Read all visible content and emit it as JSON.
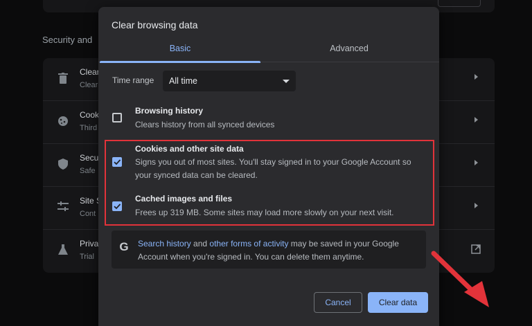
{
  "background": {
    "section_title": "Security and",
    "rows": [
      {
        "t1": "Clear",
        "t2": "Clear",
        "icon": "trash-icon"
      },
      {
        "t1": "Cook",
        "t2": "Third",
        "icon": "cookie-icon"
      },
      {
        "t1": "Secu",
        "t2": "Safe",
        "icon": "shield-icon"
      },
      {
        "t1": "Site S",
        "t2": "Cont",
        "icon": "sliders-icon"
      },
      {
        "t1": "Priva",
        "t2": "Trial",
        "icon": "flask-icon"
      }
    ]
  },
  "dialog": {
    "title": "Clear browsing data",
    "tabs": [
      {
        "label": "Basic",
        "active": true
      },
      {
        "label": "Advanced",
        "active": false
      }
    ],
    "time_range": {
      "label": "Time range",
      "value": "All time"
    },
    "options": [
      {
        "title": "Browsing history",
        "desc": "Clears history from all synced devices",
        "checked": false
      },
      {
        "title": "Cookies and other site data",
        "desc": "Signs you out of most sites. You'll stay signed in to your Google Account so your synced data can be cleared.",
        "checked": true
      },
      {
        "title": "Cached images and files",
        "desc": "Frees up 319 MB. Some sites may load more slowly on your next visit.",
        "checked": true
      }
    ],
    "google_notice": {
      "link1": "Search history",
      "mid1": " and ",
      "link2": "other forms of activity",
      "rest": " may be saved in your Google Account when you're signed in. You can delete them anytime."
    },
    "buttons": {
      "cancel": "Cancel",
      "clear": "Clear data"
    }
  },
  "colors": {
    "accent": "#8ab4f8",
    "highlight": "#e2333a",
    "dialog_bg": "#2b2b2e"
  }
}
